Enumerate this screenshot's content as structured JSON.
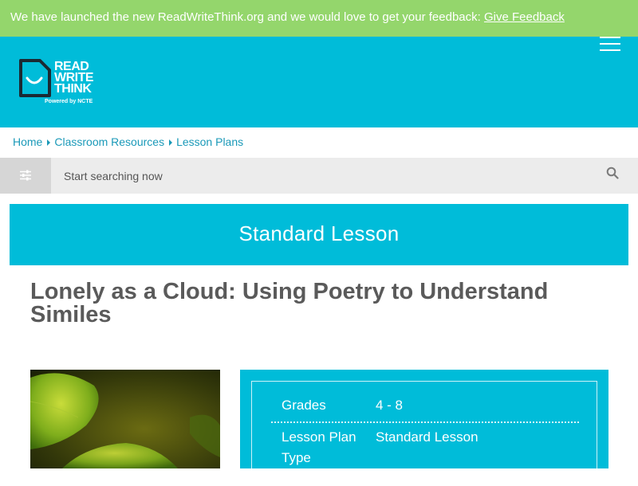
{
  "banner": {
    "text": "We have launched the new ReadWriteThink.org and we would love to get your feedback: ",
    "link": "Give Feedback"
  },
  "logo": {
    "line1": "READ",
    "line2": "WRITE",
    "line3": "THINK",
    "tagline": "Powered by NCTE"
  },
  "breadcrumb": [
    "Home",
    "Classroom Resources",
    "Lesson Plans"
  ],
  "search": {
    "placeholder": "Start searching now"
  },
  "lesson_type_banner": "Standard Lesson",
  "page_title": "Lonely as a Cloud: Using Poetry to Understand Similes",
  "info": {
    "grades_label": "Grades",
    "grades_value": "4 - 8",
    "lesson_plan_type_label": "Lesson Plan Type",
    "lesson_plan_type_value": "Standard Lesson"
  },
  "colors": {
    "banner": "#94d66c",
    "brand": "#00bcd9",
    "title": "#5a5a5a",
    "link": "#1a99b8"
  },
  "icons": [
    "hamburger-menu-icon",
    "filter-sliders-icon",
    "search-icon",
    "logo-icon"
  ]
}
